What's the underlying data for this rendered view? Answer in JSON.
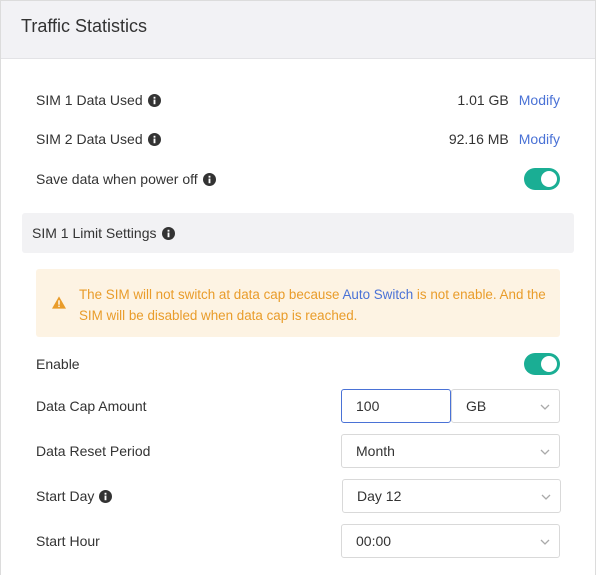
{
  "header": {
    "title": "Traffic Statistics"
  },
  "usage": {
    "sim1": {
      "label": "SIM 1 Data Used",
      "value": "1.01 GB",
      "action": "Modify"
    },
    "sim2": {
      "label": "SIM 2 Data Used",
      "value": "92.16 MB",
      "action": "Modify"
    },
    "save_data": {
      "label": "Save data when power off",
      "enabled": true
    }
  },
  "limit_section": {
    "title": "SIM 1 Limit Settings"
  },
  "alert": {
    "text_before": "The SIM will not switch at data cap because ",
    "link": "Auto Switch",
    "text_after": " is not enable. And the SIM will be disabled when data cap is reached."
  },
  "form": {
    "enable": {
      "label": "Enable",
      "enabled": true
    },
    "data_cap": {
      "label": "Data Cap Amount",
      "value": "100",
      "unit": "GB"
    },
    "reset_period": {
      "label": "Data Reset Period",
      "value": "Month"
    },
    "start_day": {
      "label": "Start Day",
      "value": "Day 12"
    },
    "start_hour": {
      "label": "Start Hour",
      "value": "00:00"
    }
  },
  "colors": {
    "accent": "#1aae94",
    "link": "#4a72d6",
    "warning_text": "#e99c2a",
    "warning_bg": "#fdf3e3"
  },
  "icons": {
    "info": "info-circle-icon",
    "warning": "warning-triangle-icon",
    "chevron": "chevron-down-icon"
  }
}
